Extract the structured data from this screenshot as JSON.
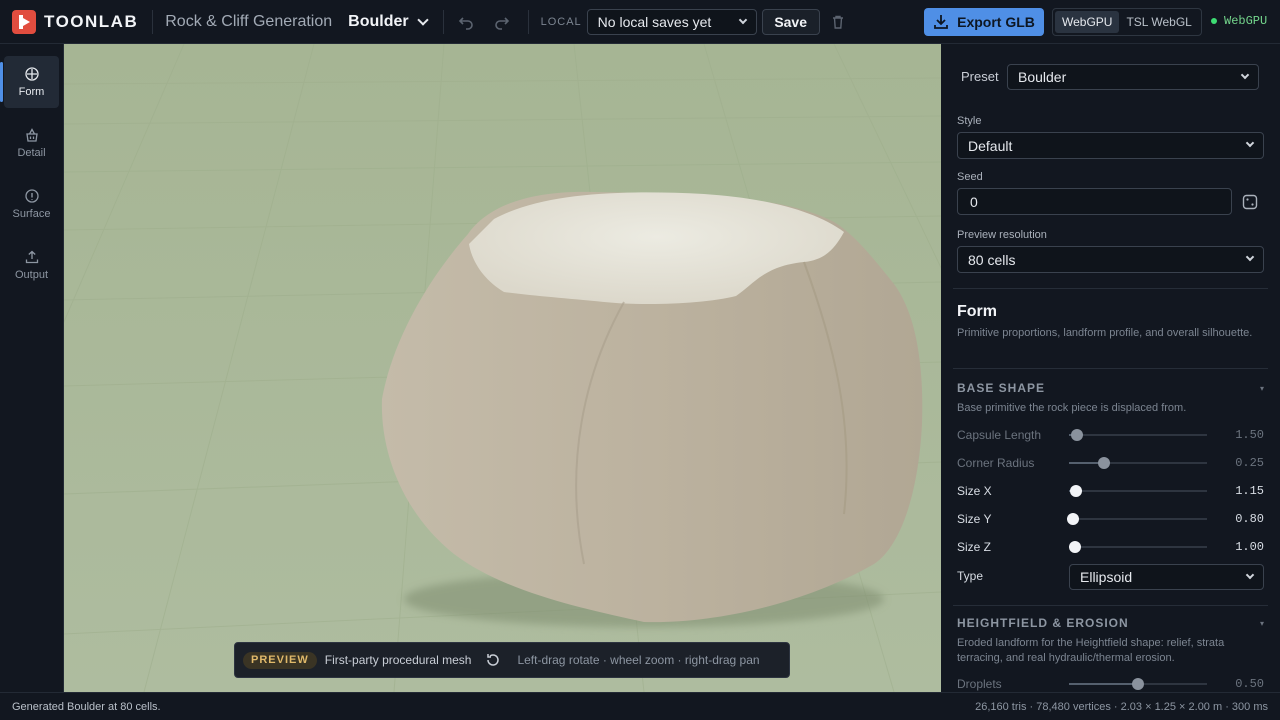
{
  "header": {
    "logo_text": "TOONLAB",
    "app_title": "Rock & Cliff Generation",
    "doc_title": "Boulder",
    "local_label": "LOCAL",
    "local_saves": "No local saves yet",
    "save_label": "Save",
    "export_label": "Export GLB",
    "renderers": [
      "WebGPU",
      "TSL WebGL"
    ],
    "active_renderer": "WebGPU",
    "status": "WebGPU"
  },
  "nav": [
    {
      "label": "Form",
      "icon": "crosshair-icon",
      "active": true
    },
    {
      "label": "Detail",
      "icon": "basket-icon",
      "active": false
    },
    {
      "label": "Surface",
      "icon": "info-icon",
      "active": false
    },
    {
      "label": "Output",
      "icon": "upload-icon",
      "active": false
    }
  ],
  "viewport": {
    "badge": "PREVIEW",
    "mesh_label": "First-party procedural mesh",
    "hint": "Left-drag rotate · wheel zoom · right-drag pan",
    "colors": {
      "background": "#a9b899",
      "rock": "#bdb3a2",
      "rock_top": "#e8e6dc"
    }
  },
  "panel": {
    "preset_label": "Preset",
    "preset_value": "Boulder",
    "style_label": "Style",
    "style_value": "Default",
    "seed_label": "Seed",
    "seed_value": "0",
    "resolution_label": "Preview resolution",
    "resolution_value": "80 cells",
    "form_title": "Form",
    "form_desc": "Primitive proportions, landform profile, and overall silhouette.",
    "base_shape_title": "BASE SHAPE",
    "base_shape_desc": "Base primitive the rock piece is displaced from.",
    "sliders": [
      {
        "label": "Capsule Length",
        "value": "1.50",
        "fraction": 0.06,
        "enabled": false
      },
      {
        "label": "Corner Radius",
        "value": "0.25",
        "fraction": 0.25,
        "enabled": false
      },
      {
        "label": "Size X",
        "value": "1.15",
        "fraction": 0.05,
        "enabled": true
      },
      {
        "label": "Size Y",
        "value": "0.80",
        "fraction": 0.03,
        "enabled": true
      },
      {
        "label": "Size Z",
        "value": "1.00",
        "fraction": 0.04,
        "enabled": true
      }
    ],
    "type_label": "Type",
    "type_value": "Ellipsoid",
    "heightfield_title": "HEIGHTFIELD & EROSION",
    "heightfield_desc": "Eroded landform for the Heightfield shape: relief, strata terracing, and real hydraulic/thermal erosion.",
    "droplets": {
      "label": "Droplets",
      "value": "0.50",
      "fraction": 0.5,
      "enabled": false
    }
  },
  "statusbar": {
    "left": "Generated Boulder at 80 cells.",
    "right": "26,160 tris · 78,480 vertices · 2.03 × 1.25 × 2.00 m · 300 ms"
  }
}
